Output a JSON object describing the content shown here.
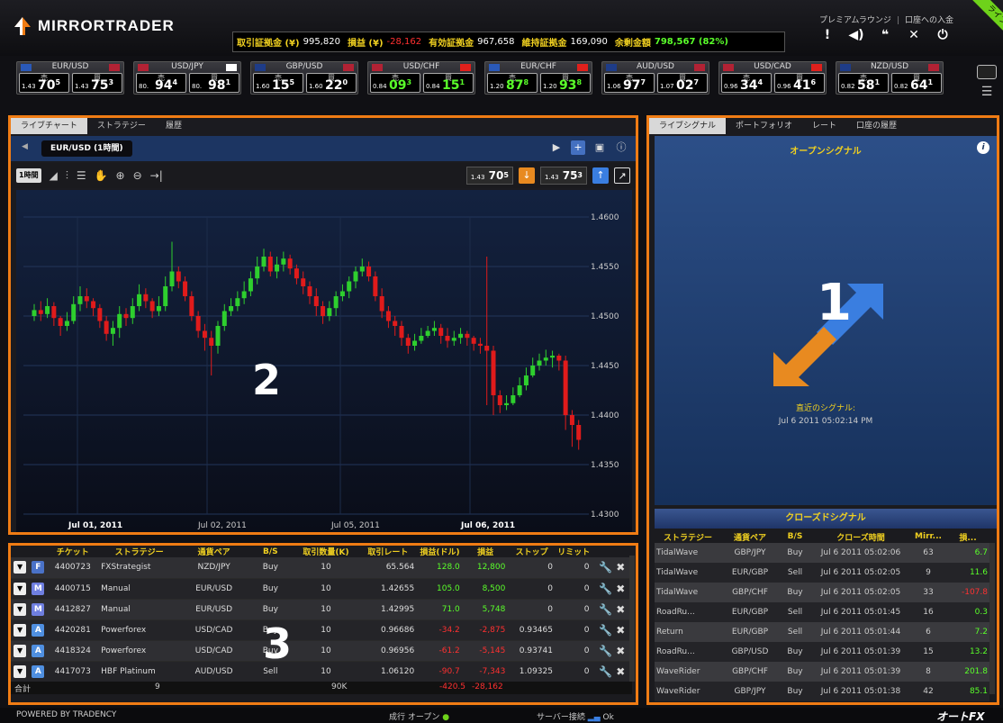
{
  "app": {
    "name": "MIRRORTRADER"
  },
  "header": {
    "links": [
      "プレミアムラウンジ",
      "口座への入金"
    ],
    "live_badge": "ライブ",
    "account": {
      "margin_label": "取引証拠金 (¥)",
      "margin_value": "995,820",
      "pl_label": "損益 (¥)",
      "pl_value": "-28,162",
      "equity_label": "有効証拠金",
      "equity_value": "967,658",
      "maint_label": "維持証拠金",
      "maint_value": "169,090",
      "surplus_label": "余剰金額",
      "surplus_value": "798,567 (82%)"
    },
    "icons": [
      "alert-icon",
      "sound-icon",
      "chat-icon",
      "tools-icon",
      "power-icon"
    ]
  },
  "currency_tiles": [
    {
      "pair": "EUR/USD",
      "sell_label": "売",
      "buy_label": "買",
      "sell_pre": "1.43",
      "sell_big": "70",
      "sell_sup": "5",
      "buy_pre": "1.43",
      "buy_big": "75",
      "buy_sup": "3",
      "flag_a": "#2a59b8",
      "flag_b": "#b22234"
    },
    {
      "pair": "USD/JPY",
      "sell_label": "売",
      "buy_label": "買",
      "sell_pre": "80.",
      "sell_big": "94",
      "sell_sup": "4",
      "buy_pre": "80.",
      "buy_big": "98",
      "buy_sup": "1",
      "flag_a": "#b22234",
      "flag_b": "#ffffff"
    },
    {
      "pair": "GBP/USD",
      "sell_label": "売",
      "buy_label": "買",
      "sell_pre": "1.60",
      "sell_big": "15",
      "sell_sup": "5",
      "buy_pre": "1.60",
      "buy_big": "22",
      "buy_sup": "0",
      "flag_a": "#1e3c88",
      "flag_b": "#b22234"
    },
    {
      "pair": "USD/CHF",
      "sell_label": "売",
      "buy_label": "買",
      "sell_pre": "0.84",
      "sell_big": "09",
      "sell_sup": "3",
      "buy_pre": "0.84",
      "buy_big": "15",
      "buy_sup": "1",
      "flag_a": "#b22234",
      "flag_b": "#e0201c"
    },
    {
      "pair": "EUR/CHF",
      "sell_label": "売",
      "buy_label": "買",
      "sell_pre": "1.20",
      "sell_big": "87",
      "sell_sup": "8",
      "buy_pre": "1.20",
      "buy_big": "93",
      "buy_sup": "8",
      "flag_a": "#2a59b8",
      "flag_b": "#e0201c"
    },
    {
      "pair": "AUD/USD",
      "sell_label": "売",
      "buy_label": "買",
      "sell_pre": "1.06",
      "sell_big": "97",
      "sell_sup": "7",
      "buy_pre": "1.07",
      "buy_big": "02",
      "buy_sup": "7",
      "flag_a": "#1e3c88",
      "flag_b": "#b22234"
    },
    {
      "pair": "USD/CAD",
      "sell_label": "売",
      "buy_label": "買",
      "sell_pre": "0.96",
      "sell_big": "34",
      "sell_sup": "4",
      "buy_pre": "0.96",
      "buy_big": "41",
      "buy_sup": "6",
      "flag_a": "#b22234",
      "flag_b": "#e0201c"
    },
    {
      "pair": "NZD/USD",
      "sell_label": "売",
      "buy_label": "買",
      "sell_pre": "0.82",
      "sell_big": "58",
      "sell_sup": "1",
      "buy_pre": "0.82",
      "buy_big": "64",
      "buy_sup": "1",
      "flag_a": "#1e3c88",
      "flag_b": "#b22234"
    }
  ],
  "left_tabs": [
    "ライブチャート",
    "ストラテジー",
    "履歴"
  ],
  "chart": {
    "symbol_label": "EUR/USD (1時間)",
    "timeframe": "1時間",
    "sell_quote": {
      "pre": "1.43",
      "big": "70",
      "sup": "5"
    },
    "buy_quote": {
      "pre": "1.43",
      "big": "75",
      "sup": "3"
    },
    "overlay_number": "2"
  },
  "chart_data": {
    "type": "candlestick",
    "ylim": [
      1.43,
      1.46
    ],
    "yticks": [
      "1.4600",
      "1.4550",
      "1.4500",
      "1.4450",
      "1.4400",
      "1.4350",
      "1.4300"
    ],
    "xticks": [
      "Jul 01, 2011",
      "Jul 02, 2011",
      "Jul 05, 2011",
      "Jul 06, 2011"
    ],
    "up_color": "#2ecf2e",
    "down_color": "#e01b1b",
    "close": [
      1.4506,
      1.4502,
      1.451,
      1.4498,
      1.449,
      1.4495,
      1.4512,
      1.452,
      1.4515,
      1.4508,
      1.4495,
      1.4482,
      1.4488,
      1.4502,
      1.4498,
      1.451,
      1.4522,
      1.4515,
      1.4505,
      1.451,
      1.453,
      1.4545,
      1.4535,
      1.452,
      1.45,
      1.4485,
      1.4478,
      1.447,
      1.449,
      1.4505,
      1.451,
      1.4518,
      1.4525,
      1.4538,
      1.455,
      1.456,
      1.4545,
      1.4552,
      1.4558,
      1.4548,
      1.4538,
      1.453,
      1.452,
      1.451,
      1.45,
      1.4508,
      1.452,
      1.4525,
      1.4535,
      1.4545,
      1.455,
      1.454,
      1.452,
      1.4505,
      1.4495,
      1.449,
      1.4478,
      1.447,
      1.4475,
      1.448,
      1.4485,
      1.4488,
      1.448,
      1.4475,
      1.4478,
      1.4482,
      1.4478,
      1.4472,
      1.447,
      1.4465,
      1.442,
      1.441,
      1.4412,
      1.442,
      1.443,
      1.444,
      1.445,
      1.4455,
      1.4458,
      1.446,
      1.4455,
      1.44,
      1.439,
      1.4375
    ],
    "open": [
      1.45,
      1.4506,
      1.4502,
      1.451,
      1.4498,
      1.449,
      1.4495,
      1.4512,
      1.452,
      1.4515,
      1.4508,
      1.4495,
      1.4482,
      1.4488,
      1.4502,
      1.4498,
      1.451,
      1.4522,
      1.4515,
      1.4505,
      1.451,
      1.453,
      1.4545,
      1.4535,
      1.452,
      1.45,
      1.4485,
      1.4478,
      1.447,
      1.449,
      1.4505,
      1.451,
      1.4518,
      1.4525,
      1.4538,
      1.455,
      1.456,
      1.4545,
      1.4552,
      1.4558,
      1.4548,
      1.4538,
      1.453,
      1.452,
      1.451,
      1.45,
      1.4508,
      1.452,
      1.4525,
      1.4535,
      1.4545,
      1.455,
      1.454,
      1.452,
      1.4505,
      1.4495,
      1.449,
      1.4478,
      1.447,
      1.4475,
      1.448,
      1.4485,
      1.4488,
      1.448,
      1.4475,
      1.4478,
      1.4482,
      1.4478,
      1.4472,
      1.447,
      1.4465,
      1.442,
      1.441,
      1.4412,
      1.442,
      1.443,
      1.444,
      1.445,
      1.4455,
      1.4458,
      1.446,
      1.4455,
      1.44,
      1.439
    ],
    "high": [
      1.4512,
      1.4515,
      1.4518,
      1.4514,
      1.45,
      1.4504,
      1.452,
      1.453,
      1.4528,
      1.4518,
      1.4512,
      1.45,
      1.4495,
      1.451,
      1.4508,
      1.4518,
      1.4532,
      1.4528,
      1.4518,
      1.452,
      1.454,
      1.4575,
      1.455,
      1.454,
      1.4525,
      1.4505,
      1.4492,
      1.4485,
      1.4495,
      1.4512,
      1.4518,
      1.4525,
      1.4535,
      1.4545,
      1.456,
      1.4568,
      1.4565,
      1.456,
      1.4565,
      1.4562,
      1.4552,
      1.4545,
      1.4535,
      1.4528,
      1.4515,
      1.4515,
      1.4525,
      1.4532,
      1.454,
      1.455,
      1.4558,
      1.4555,
      1.4545,
      1.4528,
      1.451,
      1.45,
      1.4495,
      1.4482,
      1.4482,
      1.4488,
      1.449,
      1.4495,
      1.4492,
      1.4488,
      1.4485,
      1.4488,
      1.4485,
      1.448,
      1.4478,
      1.456,
      1.447,
      1.4425,
      1.442,
      1.4428,
      1.4438,
      1.4448,
      1.4458,
      1.4462,
      1.4466,
      1.4465,
      1.4462,
      1.446,
      1.4405,
      1.4395
    ],
    "low": [
      1.4495,
      1.4495,
      1.4498,
      1.449,
      1.448,
      1.4485,
      1.4492,
      1.4505,
      1.4508,
      1.45,
      1.4488,
      1.4475,
      1.447,
      1.4478,
      1.449,
      1.4492,
      1.4505,
      1.4508,
      1.4498,
      1.45,
      1.4505,
      1.4525,
      1.4528,
      1.4515,
      1.4495,
      1.4478,
      1.4465,
      1.444,
      1.4462,
      1.4485,
      1.45,
      1.4505,
      1.4512,
      1.452,
      1.4532,
      1.4545,
      1.454,
      1.4538,
      1.4545,
      1.4542,
      1.4532,
      1.4522,
      1.4512,
      1.45,
      1.4492,
      1.4495,
      1.45,
      1.4515,
      1.4518,
      1.4528,
      1.454,
      1.4535,
      1.4515,
      1.4498,
      1.4488,
      1.448,
      1.447,
      1.4462,
      1.4465,
      1.4472,
      1.4478,
      1.448,
      1.4472,
      1.4468,
      1.447,
      1.4472,
      1.447,
      1.4465,
      1.4462,
      1.441,
      1.44,
      1.4402,
      1.4405,
      1.441,
      1.4418,
      1.4425,
      1.4438,
      1.4445,
      1.445,
      1.4448,
      1.4445,
      1.4385,
      1.4368,
      1.4365
    ]
  },
  "positions": {
    "headers": [
      "",
      "",
      "チケット",
      "ストラテジー",
      "通貨ペア",
      "B/S",
      "取引数量(K)",
      "取引レート",
      "損益(ドル)",
      "損益",
      "ストップ",
      "リミット",
      ""
    ],
    "rows": [
      {
        "icon": "F",
        "ticket": "4400723",
        "strategy": "FXStrategist",
        "pair": "NZD/JPY",
        "bs": "Buy",
        "qty": "10",
        "rate": "65.564",
        "pips": "128.0",
        "pl": "12,800",
        "stop": "0",
        "limit": "0",
        "pips_neg": false
      },
      {
        "icon": "M",
        "ticket": "4400715",
        "strategy": "Manual",
        "pair": "EUR/USD",
        "bs": "Buy",
        "qty": "10",
        "rate": "1.42655",
        "pips": "105.0",
        "pl": "8,500",
        "stop": "0",
        "limit": "0",
        "pips_neg": false
      },
      {
        "icon": "M",
        "ticket": "4412827",
        "strategy": "Manual",
        "pair": "EUR/USD",
        "bs": "Buy",
        "qty": "10",
        "rate": "1.42995",
        "pips": "71.0",
        "pl": "5,748",
        "stop": "0",
        "limit": "0",
        "pips_neg": false
      },
      {
        "icon": "A",
        "ticket": "4420281",
        "strategy": "Powerforex",
        "pair": "USD/CAD",
        "bs": "Buy",
        "qty": "10",
        "rate": "0.96686",
        "pips": "-34.2",
        "pl": "-2,875",
        "stop": "0.93465",
        "limit": "0",
        "pips_neg": true
      },
      {
        "icon": "A",
        "ticket": "4418324",
        "strategy": "Powerforex",
        "pair": "USD/CAD",
        "bs": "Buy",
        "qty": "10",
        "rate": "0.96956",
        "pips": "-61.2",
        "pl": "-5,145",
        "stop": "0.93741",
        "limit": "0",
        "pips_neg": true
      },
      {
        "icon": "A",
        "ticket": "4417073",
        "strategy": "HBF Platinum",
        "pair": "AUD/USD",
        "bs": "Sell",
        "qty": "10",
        "rate": "1.06120",
        "pips": "-90.7",
        "pl": "-7,343",
        "stop": "1.09325",
        "limit": "0",
        "pips_neg": true
      }
    ],
    "total_label": "合計",
    "total_count": "9",
    "total_qty": "90K",
    "total_pips": "-420.5",
    "total_pl": "-28,162",
    "overlay_number": "3"
  },
  "right_tabs": [
    "ライブシグナル",
    "ポートフォリオ",
    "レート",
    "口座の履歴"
  ],
  "open_signal": {
    "title": "オープンシグナル",
    "overlay_number": "1",
    "recent_label": "直近のシグナル:",
    "recent_time": "Jul 6 2011 05:02:14 PM"
  },
  "closed_signal": {
    "title": "クローズドシグナル",
    "headers": [
      "ストラテジー",
      "通貨ペア",
      "B/S",
      "クローズ時間",
      "Mirr...",
      "損..."
    ],
    "rows": [
      {
        "strategy": "TidalWave",
        "pair": "GBP/JPY",
        "bs": "Buy",
        "time": "Jul 6 2011 05:02:06",
        "mirr": "63",
        "pl": "6.7",
        "neg": false
      },
      {
        "strategy": "TidalWave",
        "pair": "EUR/GBP",
        "bs": "Sell",
        "time": "Jul 6 2011 05:02:05",
        "mirr": "9",
        "pl": "11.6",
        "neg": false
      },
      {
        "strategy": "TidalWave",
        "pair": "GBP/CHF",
        "bs": "Buy",
        "time": "Jul 6 2011 05:02:05",
        "mirr": "33",
        "pl": "-107.8",
        "neg": true
      },
      {
        "strategy": "RoadRu...",
        "pair": "EUR/GBP",
        "bs": "Sell",
        "time": "Jul 6 2011 05:01:45",
        "mirr": "16",
        "pl": "0.3",
        "neg": false
      },
      {
        "strategy": "Return",
        "pair": "EUR/GBP",
        "bs": "Sell",
        "time": "Jul 6 2011 05:01:44",
        "mirr": "6",
        "pl": "7.2",
        "neg": false
      },
      {
        "strategy": "RoadRu...",
        "pair": "GBP/USD",
        "bs": "Buy",
        "time": "Jul 6 2011 05:01:39",
        "mirr": "15",
        "pl": "13.2",
        "neg": false
      },
      {
        "strategy": "WaveRider",
        "pair": "GBP/CHF",
        "bs": "Buy",
        "time": "Jul 6 2011 05:01:39",
        "mirr": "8",
        "pl": "201.8",
        "neg": false
      },
      {
        "strategy": "WaveRider",
        "pair": "GBP/JPY",
        "bs": "Buy",
        "time": "Jul 6 2011 05:01:38",
        "mirr": "42",
        "pl": "85.1",
        "neg": false
      }
    ]
  },
  "footer": {
    "powered": "POWERED BY TRADENCY",
    "mode": "成行 オープン",
    "server": "サーバー接続",
    "server_status": "Ok",
    "brand": "オートFX"
  },
  "colors": {
    "accent_frame": "#f07c14",
    "profit": "#5aff2a",
    "loss": "#ff3030",
    "label_yellow": "#f0d020"
  }
}
